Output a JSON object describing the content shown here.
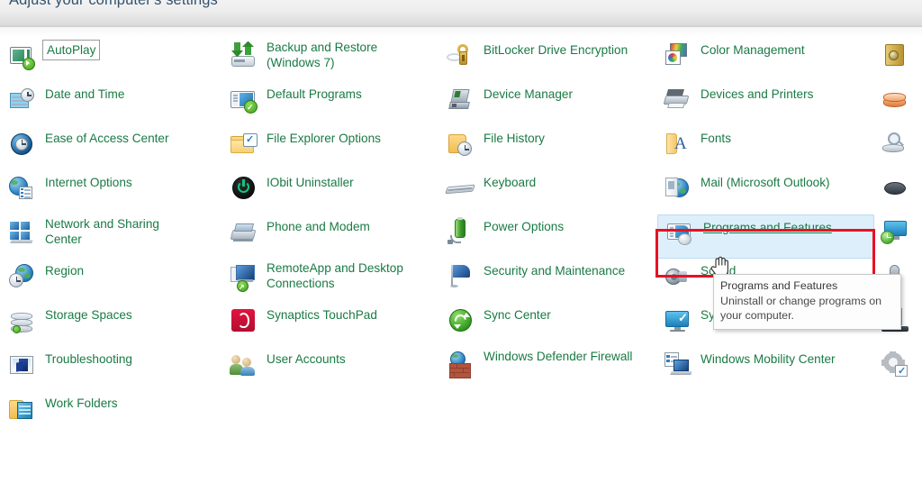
{
  "window": {
    "header_title": "Adjust your computer's settings",
    "view_background": "#ffffff",
    "link_color": "#1a7a44",
    "header_text_color": "#33526e"
  },
  "annotation": {
    "highlight_color": "#e81123",
    "highlight_target": "Programs and Features"
  },
  "hover": {
    "item": "Programs and Features",
    "background": "#ddeffb",
    "border": "#b8dcf2"
  },
  "tooltip": {
    "title": "Programs and Features",
    "body": "Uninstall or change programs on your computer.",
    "background": "#fdfdfd",
    "border": "#c9c9c9"
  },
  "columns": [
    {
      "index": 0,
      "items": [
        {
          "label": "AutoPlay",
          "icon": "autoplay-icon",
          "focused": true
        },
        {
          "label": "Date and Time",
          "icon": "date-and-time-icon"
        },
        {
          "label": "Ease of Access Center",
          "icon": "ease-of-access-center-icon"
        },
        {
          "label": "Internet Options",
          "icon": "internet-options-icon"
        },
        {
          "label": "Network and Sharing Center",
          "icon": "network-and-sharing-center-icon",
          "two_line": true
        },
        {
          "label": "Region",
          "icon": "region-icon"
        },
        {
          "label": "Storage Spaces",
          "icon": "storage-spaces-icon"
        },
        {
          "label": "Troubleshooting",
          "icon": "troubleshooting-icon"
        },
        {
          "label": "Work Folders",
          "icon": "work-folders-icon"
        }
      ]
    },
    {
      "index": 1,
      "items": [
        {
          "label": "Backup and Restore (Windows 7)",
          "icon": "backup-and-restore-icon",
          "two_line": true
        },
        {
          "label": "Default Programs",
          "icon": "default-programs-icon"
        },
        {
          "label": "File Explorer Options",
          "icon": "file-explorer-options-icon"
        },
        {
          "label": "IObit Uninstaller",
          "icon": "iobit-uninstaller-icon"
        },
        {
          "label": "Phone and Modem",
          "icon": "phone-and-modem-icon"
        },
        {
          "label": "RemoteApp and Desktop Connections",
          "icon": "remoteapp-and-desktop-connections-icon",
          "two_line": true
        },
        {
          "label": "Synaptics TouchPad",
          "icon": "synaptics-touchpad-icon"
        },
        {
          "label": "User Accounts",
          "icon": "user-accounts-icon"
        }
      ]
    },
    {
      "index": 2,
      "items": [
        {
          "label": "BitLocker Drive Encryption",
          "icon": "bitlocker-drive-encryption-icon"
        },
        {
          "label": "Device Manager",
          "icon": "device-manager-icon"
        },
        {
          "label": "File History",
          "icon": "file-history-icon"
        },
        {
          "label": "Keyboard",
          "icon": "keyboard-icon"
        },
        {
          "label": "Power Options",
          "icon": "power-options-icon"
        },
        {
          "label": "Security and Maintenance",
          "icon": "security-and-maintenance-icon"
        },
        {
          "label": "Sync Center",
          "icon": "sync-center-icon"
        },
        {
          "label": "Windows Defender Firewall",
          "icon": "windows-defender-firewall-icon",
          "two_line": true
        }
      ]
    },
    {
      "index": 3,
      "items": [
        {
          "label": "Color Management",
          "icon": "color-management-icon"
        },
        {
          "label": "Devices and Printers",
          "icon": "devices-and-printers-icon"
        },
        {
          "label": "Fonts",
          "icon": "fonts-icon"
        },
        {
          "label": "Mail (Microsoft Outlook)",
          "icon": "mail-icon"
        },
        {
          "label": "Programs and Features",
          "icon": "programs-and-features-icon",
          "hovered": true
        },
        {
          "label": "Sound",
          "icon": "sound-icon",
          "occluded": true
        },
        {
          "label": "System",
          "icon": "system-icon"
        },
        {
          "label": "Windows Mobility Center",
          "icon": "windows-mobility-center-icon"
        }
      ]
    },
    {
      "index": 4,
      "clipped": true,
      "items": [
        {
          "label": "",
          "icon": "credential-manager-icon"
        },
        {
          "label": "",
          "icon": "indexing-options-icon"
        },
        {
          "label": "",
          "icon": "recovery-icon"
        },
        {
          "label": "",
          "icon": "mouse-icon"
        },
        {
          "label": "",
          "icon": "remote-desktop-icon"
        },
        {
          "label": "",
          "icon": "speech-recognition-icon"
        },
        {
          "label": "",
          "icon": "taskbar-and-navigation-icon"
        },
        {
          "label": "",
          "icon": "administrative-tools-icon"
        }
      ]
    }
  ]
}
